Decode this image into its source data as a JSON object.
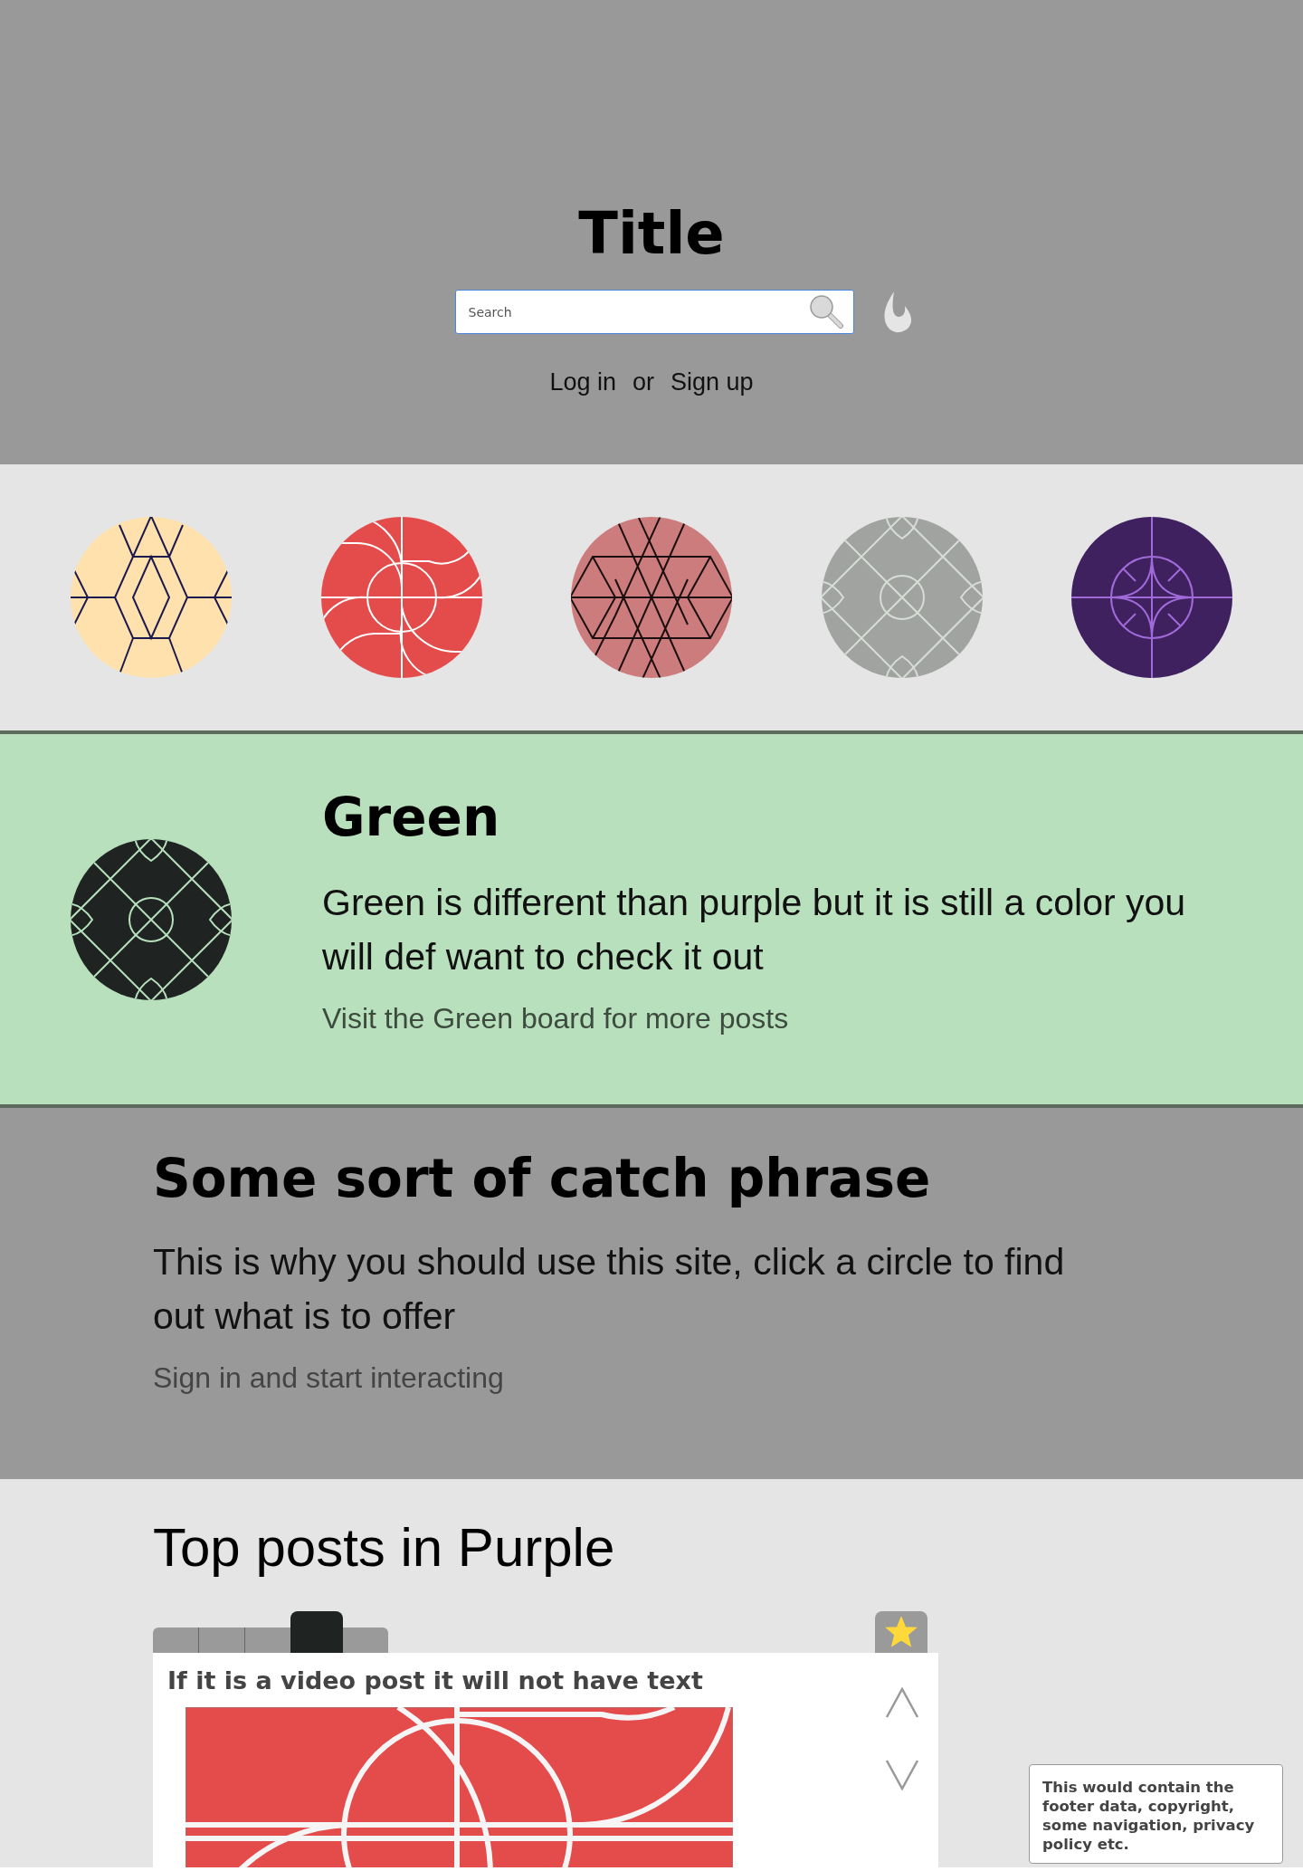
{
  "header": {
    "title": "Title",
    "search": {
      "placeholder": "Search"
    },
    "auth": {
      "login": "Log in",
      "separator": "or",
      "signup": "Sign up"
    }
  },
  "boards": [
    {
      "kind": "hexagon",
      "color": "#fee1ad"
    },
    {
      "kind": "curves",
      "color": "#e44c4c"
    },
    {
      "kind": "hexgrid",
      "color": "#cc7c7c"
    },
    {
      "kind": "lattice",
      "color": "#a1a3a1"
    },
    {
      "kind": "star",
      "color": "#3f2160"
    }
  ],
  "featured": {
    "kind": "lattice",
    "color": "#1f2322",
    "title": "Green",
    "description": "Green is different than purple but it is still a color you will def want to check it out",
    "link": "Visit the Green board for more posts"
  },
  "pitch": {
    "heading": "Some sort of catch phrase",
    "text": "This is why you should use this site, click a circle to find out what is to offer",
    "link": "Sign in and start interacting"
  },
  "top_posts": {
    "heading": "Top posts in Purple",
    "tabs": [
      {
        "selected": false
      },
      {
        "selected": false
      },
      {
        "selected": false
      },
      {
        "selected": true
      },
      {
        "selected": false
      }
    ],
    "favorite": {
      "on": true
    },
    "post": {
      "title": "If it is a video post it will not have text"
    }
  },
  "footer": {
    "text": "This would contain the footer data, copyright, some navigation, privacy policy etc."
  }
}
